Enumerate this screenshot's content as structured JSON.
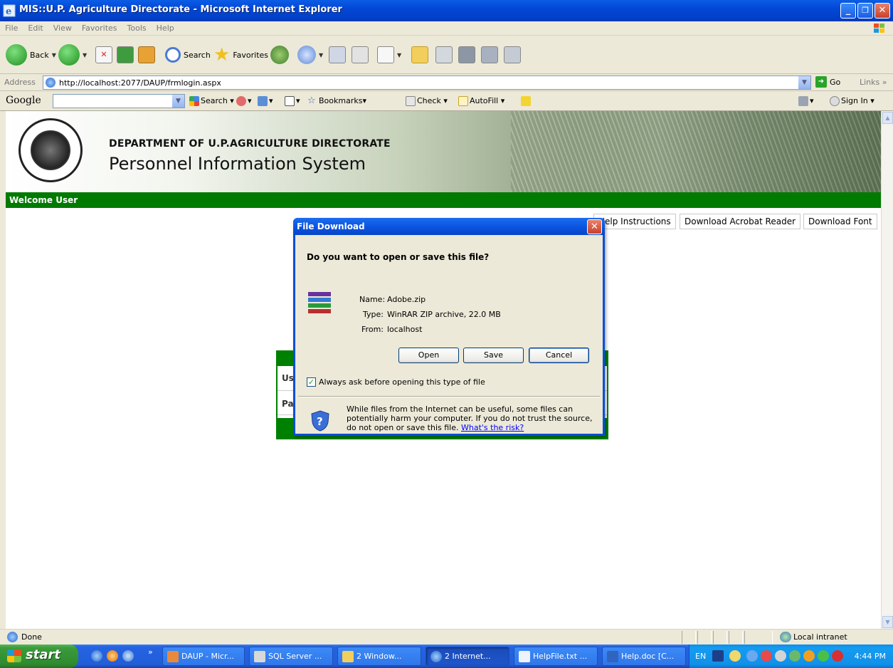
{
  "window": {
    "title": "MIS::U.P. Agriculture Directorate - Microsoft Internet Explorer",
    "minimize": "_",
    "maximize": "❐",
    "close": "✕"
  },
  "menu": [
    "File",
    "Edit",
    "View",
    "Favorites",
    "Tools",
    "Help"
  ],
  "toolbar": {
    "back": "Back",
    "search": "Search",
    "favorites": "Favorites"
  },
  "address": {
    "label": "Address",
    "url": "http://localhost:2077/DAUP/frmlogin.aspx",
    "go": "Go",
    "links": "Links »"
  },
  "googlebar": {
    "logo": "Google",
    "search": "Search ▾",
    "bookmarks": "Bookmarks▾",
    "check": "Check ▾",
    "autofill": "AutoFill ▾",
    "signin": "Sign In ▾"
  },
  "page": {
    "dept": "DEPARTMENT OF U.P.AGRICULTURE DIRECTORATE",
    "system": "Personnel Information System",
    "welcome": "Welcome User",
    "links": [
      "Help Instructions",
      "Download Acrobat Reader",
      "Download Font"
    ],
    "login": {
      "user_label": "Us",
      "pass_label": "Pa"
    }
  },
  "dialog": {
    "title": "File Download",
    "question": "Do you want to open or save this file?",
    "name_label": "Name:",
    "name_value": "Adobe.zip",
    "type_label": "Type:",
    "type_value": "WinRAR ZIP archive, 22.0 MB",
    "from_label": "From:",
    "from_value": "localhost",
    "open": "Open",
    "save": "Save",
    "cancel": "Cancel",
    "always_ask": "Always ask before opening this type of file",
    "warning": "While files from the Internet can be useful, some files can potentially harm your computer. If you do not trust the source, do not open or save this file.",
    "risk_link": "What's the risk?"
  },
  "status": {
    "text": "Done",
    "zone": "Local intranet"
  },
  "taskbar": {
    "start": "start",
    "tasks": [
      "DAUP - Micr...",
      "SQL Server ...",
      "2 Window...",
      "2 Internet...",
      "HelpFile.txt ...",
      "Help.doc [C..."
    ],
    "lang": "EN",
    "clock": "4:44 PM"
  }
}
